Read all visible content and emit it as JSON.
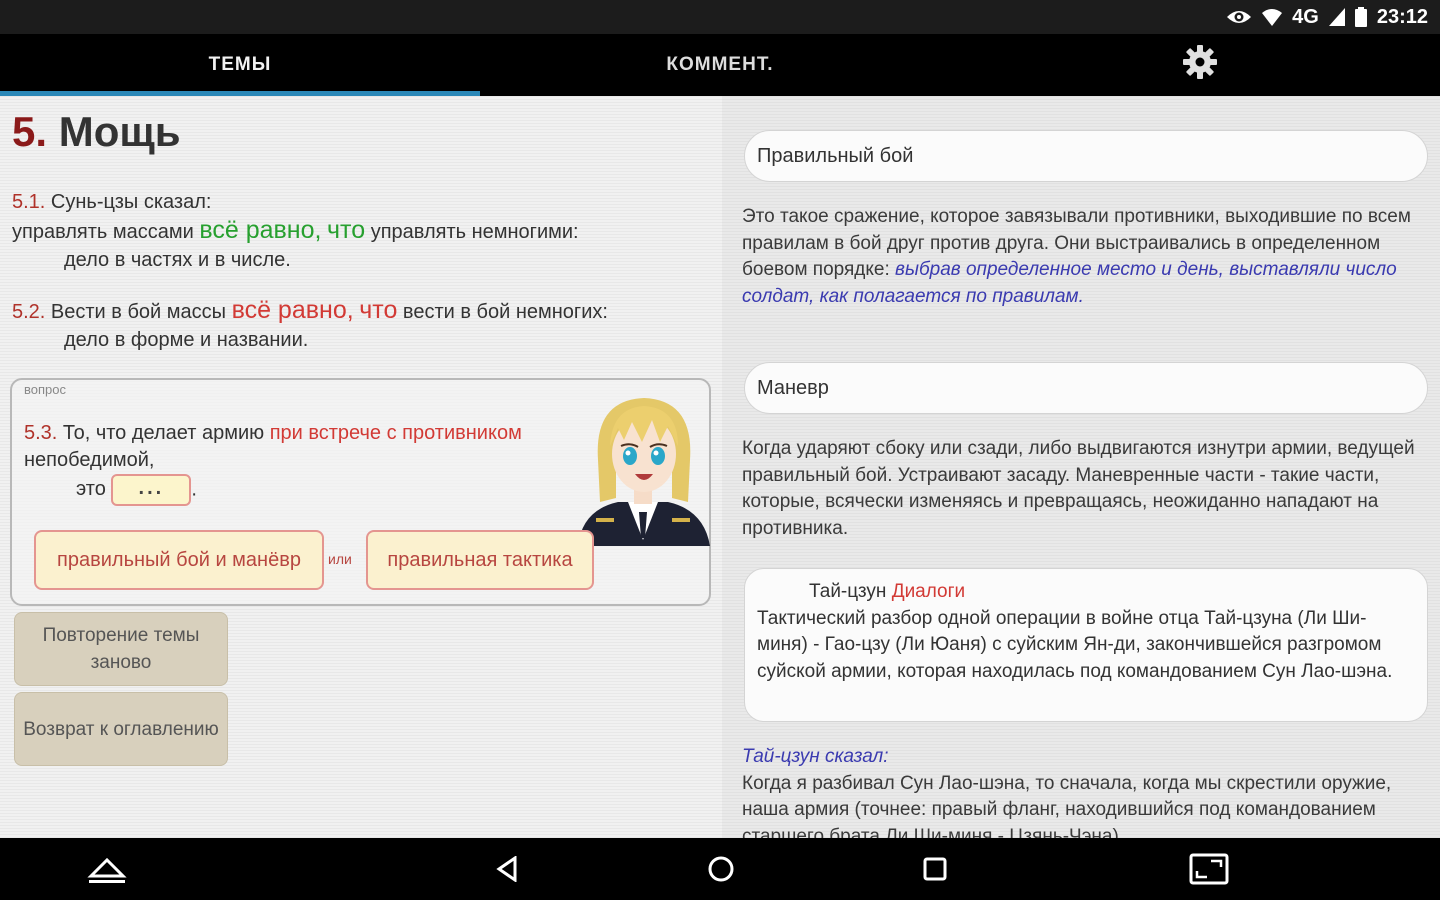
{
  "status_bar": {
    "network": "4G",
    "time": "23:12"
  },
  "tabs": [
    {
      "label": "ТЕМЫ",
      "active": true
    },
    {
      "label": "КОММЕНТ.",
      "active": false
    }
  ],
  "settings_icon": "gear-icon",
  "topic": {
    "number": "5.",
    "title": "Мощь"
  },
  "verse_5_1": {
    "num": "5.1.",
    "intro": "Сунь-цзы сказал:",
    "line_a": "управлять массами",
    "hl_1": "всё равно,",
    "hl_2": "что",
    "line_b": "управлять немногими:",
    "line_c": "дело в частях и в числе."
  },
  "verse_5_2": {
    "num": "5.2.",
    "line_a": "Вести в бой массы",
    "hl_1": "всё равно,",
    "hl_2": "что",
    "line_b": "вести в бой немногих:",
    "line_c": "дело в форме и названии."
  },
  "question": {
    "label": "вопрос",
    "num": "5.3.",
    "text_a": "То, что делает армию",
    "text_red": "при встрече с противником",
    "text_b": "непобедимой,",
    "text_c": "это",
    "blank": "...",
    "dot": ".",
    "answer_1": "правильный бой и манёвр",
    "or": "или",
    "answer_2": "правильная тактика"
  },
  "buttons": {
    "repeat": "Повторение темы заново",
    "back": "Возврат к оглавлению"
  },
  "right": {
    "pill_1": "Правильный бой",
    "text_1": "Это такое сражение, которое завязывали противники, выходившие по всем правилам в бой друг против друга. Они выстраивались в определенном боевом порядке:",
    "text_1_italic": "выбрав определенное место и день, выставляли число солдат, как полагается по правилам.",
    "pill_2": "Маневр",
    "text_2": "Когда ударяют сбоку или сзади, либо выдвигаются изнутри армии, ведущей правильный бой. Устраивают засаду. Маневренные части - такие части, которые, всячески изменяясь и превращаясь, неожиданно нападают на противника.",
    "dialog_head": "Тай-цзун",
    "dialog_link": "Диалоги",
    "dialog_body": "Тактический разбор одной операции в войне отца Тай-цзуна (Ли Ши-миня) - Гао-цзу (Ли Юаня) с суйским Ян-ди, закончившейся разгромом суйской армии, которая находилась под командованием Сун Лао-шэна.",
    "quote_head": "Тай-цзун сказал:",
    "quote_body": "Когда я разбивал Сун Лао-шэна, то сначала, когда мы скрестили оружие, наша армия (точнее: правый фланг, находившийся под командованием старшего брата Ли Ши-миня - Цзянь-Чэна)"
  },
  "nav_icons": [
    "up-triangle-icon",
    "back-icon",
    "home-icon",
    "recents-icon",
    "screenshot-icon"
  ],
  "colors": {
    "accent": "#2a88b8",
    "title_number": "#8b1a1a",
    "highlight_green": "#27a02f",
    "highlight_red": "#d23a35",
    "italic_blue": "#3a3ab0"
  }
}
